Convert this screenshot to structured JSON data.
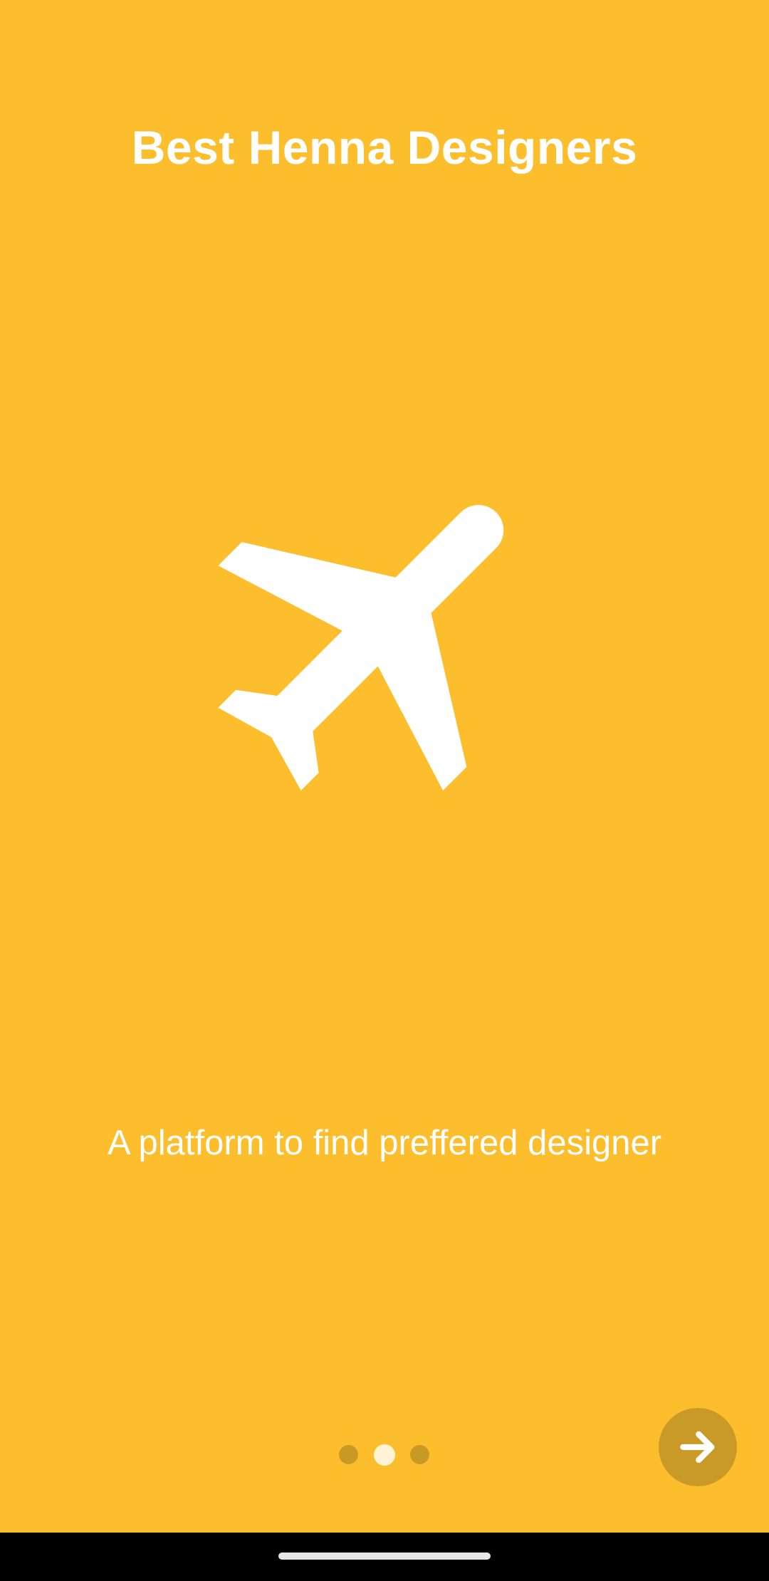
{
  "onboarding": {
    "title": "Best Henna Designers",
    "hero_icon": "airplane-icon",
    "description": "A platform to find preffered designer",
    "pages": {
      "total": 3,
      "active": 2
    },
    "next_button_icon": "arrow-right-icon"
  },
  "system": {
    "nav_handle": "home-handle"
  },
  "colors": {
    "background": "#FDBE2D",
    "foreground": "#FFFFFF",
    "accent_dark": "#C99A28",
    "dot_inactive": "#C89A25",
    "dot_active": "#FFF3D6"
  }
}
